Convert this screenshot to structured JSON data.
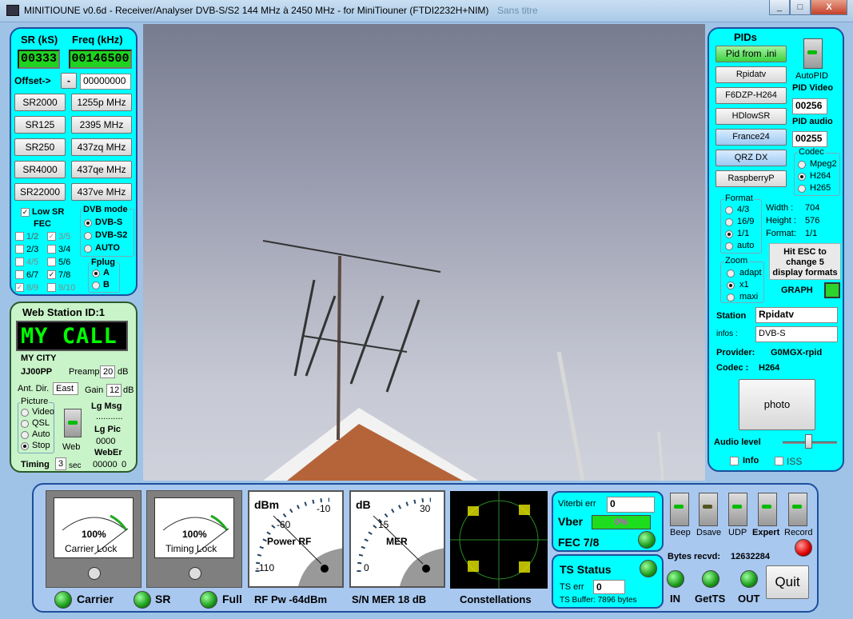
{
  "window": {
    "title": "MINITIOUNE v0.6d - Receiver/Analyser DVB-S/S2 144 MHz à 2450 MHz - for MiniTiouner (FTDI2232H+NIM)",
    "ghost_tab": "Sans titre",
    "min": "_",
    "max": "□",
    "close": "X"
  },
  "left": {
    "sr_label": "SR (kS)",
    "freq_label": "Freq (kHz)",
    "sr_value": "00333",
    "freq_value": "00146500",
    "offset_label": "Offset->",
    "offset_btn": "-",
    "offset_value": "00000000",
    "sr_buttons": [
      "SR2000",
      "SR125",
      "SR250",
      "SR4000",
      "SR22000"
    ],
    "freq_buttons": [
      "1255p MHz",
      "2395 MHz",
      "437zq MHz",
      "437qe MHz",
      "437ve MHz"
    ],
    "low_sr": "Low SR",
    "fec_label": "FEC",
    "fec": [
      [
        "1/2",
        "3/5"
      ],
      [
        "2/3",
        "3/4"
      ],
      [
        "4/5",
        "5/6"
      ],
      [
        "6/7",
        "7/8"
      ],
      [
        "8/9",
        "9/10"
      ]
    ],
    "dvb_label": "DVB mode",
    "dvb": [
      "DVB-S",
      "DVB-S2",
      "AUTO"
    ],
    "fplug": "Fplug",
    "fplug_opts": [
      "A",
      "B"
    ]
  },
  "web": {
    "title": "Web Station ID:1",
    "call": "MY CALL",
    "city": "MY CITY",
    "locator": "JJ00PP",
    "preamp_label": "Preamp",
    "preamp": "20",
    "db": "dB",
    "ant_label": "Ant. Dir.",
    "ant": "East",
    "gain_label": "Gain",
    "gain": "12",
    "picture": "Picture",
    "pic_opts": [
      "Video",
      "QSL",
      "Auto",
      "Stop"
    ],
    "web_btn": "Web",
    "lgmsg": "Lg Msg",
    "dots": "...........",
    "lgpic": "Lg Pic",
    "lgpic_v": "0000",
    "weber": "WebEr",
    "weber_v": "00000",
    "weber_v2": "0",
    "timing": "Timing",
    "timing_v": "3",
    "sec": "sec"
  },
  "pids": {
    "title": "PIDs",
    "buttons": [
      "Pid from .ini",
      "Rpidatv",
      "F6DZP-H264",
      "HDlowSR",
      "France24",
      "QRZ DX",
      "RaspberryP"
    ],
    "autopid": "AutoPID",
    "pid_video_label": "PID Video",
    "pid_video": "00256",
    "pid_audio_label": "PID audio",
    "pid_audio": "00255",
    "codec": "Codec",
    "codec_opts": [
      "Mpeg2",
      "H264",
      "H265"
    ],
    "format": "Format",
    "format_opts": [
      "4/3",
      "16/9",
      "1/1",
      "auto"
    ],
    "width_l": "Width :",
    "width": "704",
    "height_l": "Height :",
    "height": "576",
    "format_l": "Format:",
    "format_v": "1/1",
    "zoom": "Zoom",
    "zoom_opts": [
      "adapt",
      "x1",
      "maxi"
    ],
    "esc_msg": [
      "Hit ESC to",
      "change  5",
      "display formats"
    ],
    "graph": "GRAPH",
    "station_l": "Station",
    "station": "Rpidatv",
    "infos_l": "infos :",
    "infos": "DVB-S",
    "provider_l": "Provider:",
    "provider": "G0MGX-rpid",
    "codec_l": "Codec :",
    "codec_v": "H264",
    "photo": "photo",
    "audio": "Audio level",
    "info": "Info",
    "iss": "ISS"
  },
  "bottom": {
    "meters": [
      {
        "pct": "100%",
        "name": "Carrier Lock"
      },
      {
        "pct": "100%",
        "name": "Timing Lock"
      }
    ],
    "power": {
      "unit": "dBm",
      "t1": "-10",
      "t2": "-60",
      "t3": "-110",
      "name": "Power RF"
    },
    "mer": {
      "unit": "dB",
      "t1": "30",
      "t2": "15",
      "t3": "0",
      "name": "MER"
    },
    "labels": {
      "carrier": "Carrier",
      "sr": "SR",
      "full": "Full",
      "rfpw": "RF Pw -64dBm",
      "snmer": "S/N MER   18 dB",
      "const": "Constellations"
    },
    "viterbi_l": "Viterbi err",
    "viterbi": "0",
    "vber_l": "Vber",
    "vber": "0%",
    "fec": "FEC 7/8",
    "ts_status": "TS Status",
    "ts_err_l": "TS err",
    "ts_err": "0",
    "ts_buffer": "TS Buffer: 7896 bytes",
    "toggles": [
      "Beep",
      "Dsave",
      "UDP",
      "Expert",
      "Record"
    ],
    "bytes_l": "Bytes recvd:",
    "bytes": "12632284",
    "in": "IN",
    "getts": "GetTS",
    "out": "OUT",
    "quit": "Quit"
  }
}
